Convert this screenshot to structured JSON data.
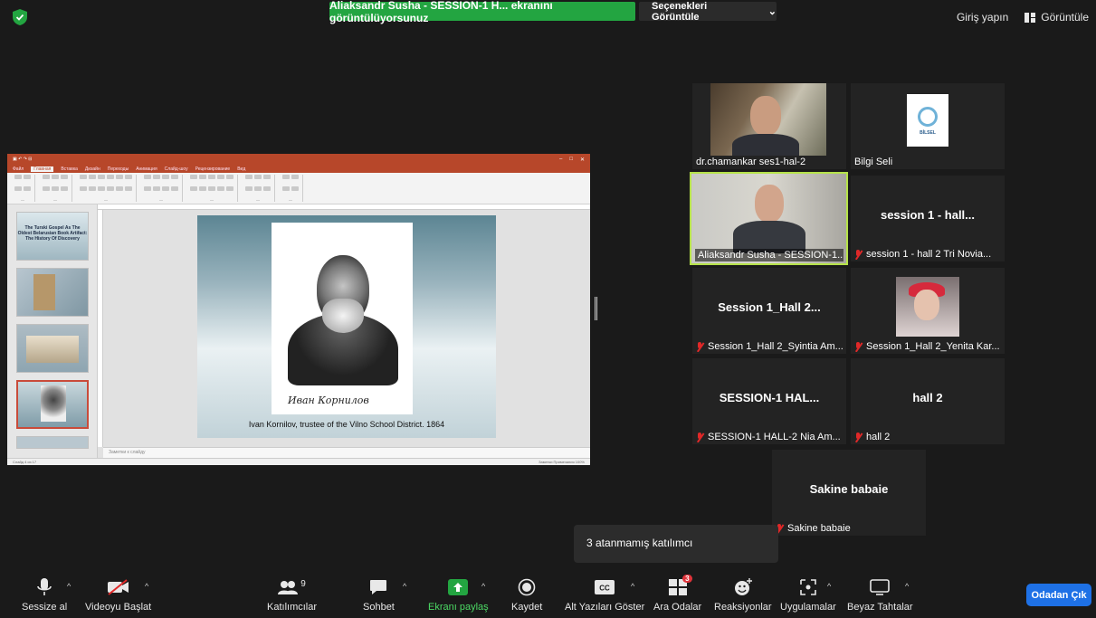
{
  "top_bar": {
    "share_banner": "Aliaksandr Susha - SESSION-1 H... ekranını görüntülüyorsunuz",
    "view_options": "Seçenekleri Görüntüle",
    "sign_in": "Giriş yapın",
    "view": "Görüntüle"
  },
  "shared_screen": {
    "slide_caption": "Ivan Kornilov, trustee of the Vilno School District. 1864",
    "thumb1_title": "The Turski Gospel As The Oldest Belarusian Book Artifact: The History Of Discovery",
    "notes_placeholder": "Заметки к слайду",
    "status_left": "Слайд 4 из 17",
    "status_right": "Заметки   Примечания   100%"
  },
  "gallery": [
    {
      "name": "dr.chamankar ses1-hal-2",
      "type": "video"
    },
    {
      "name": "Bilgi Seli",
      "type": "logo",
      "logo_text": "BİLSEL"
    },
    {
      "name": "Aliaksandr Susha - SESSION-1...",
      "type": "video"
    },
    {
      "title": "session 1 - hall...",
      "name": "session 1 - hall 2 Tri Novia...",
      "muted": true
    },
    {
      "title": "Session 1_Hall 2...",
      "name": "Session 1_Hall 2_Syintia Am...",
      "muted": true
    },
    {
      "name": "Session 1_Hall 2_Yenita Kar...",
      "muted": true,
      "type": "video"
    },
    {
      "title": "SESSION-1 HAL...",
      "name": "SESSION-1 HALL-2 Nia Am...",
      "muted": true
    },
    {
      "title": "hall 2",
      "name": "hall 2",
      "muted": true
    },
    {
      "title": "Sakine babaie",
      "name": "Sakine babaie",
      "muted": true
    }
  ],
  "tooltip": "3 atanmamış katılımcı",
  "toolbar": {
    "mute": "Sessize al",
    "start_video": "Videoyu Başlat",
    "participants": "Katılımcılar",
    "participants_count": "9",
    "chat": "Sohbet",
    "share_screen": "Ekranı paylaş",
    "record": "Kaydet",
    "captions": "Alt Yazıları Göster",
    "breakout": "Ara Odalar",
    "breakout_badge": "3",
    "reactions": "Reaksiyonlar",
    "apps": "Uygulamalar",
    "whiteboard": "Beyaz Tahtalar",
    "leave": "Odadan Çık"
  },
  "colors": {
    "share_green": "#23a541",
    "leave_blue": "#1e71e6",
    "active_speaker": "#b6e24a",
    "mute_red": "#e02828"
  }
}
